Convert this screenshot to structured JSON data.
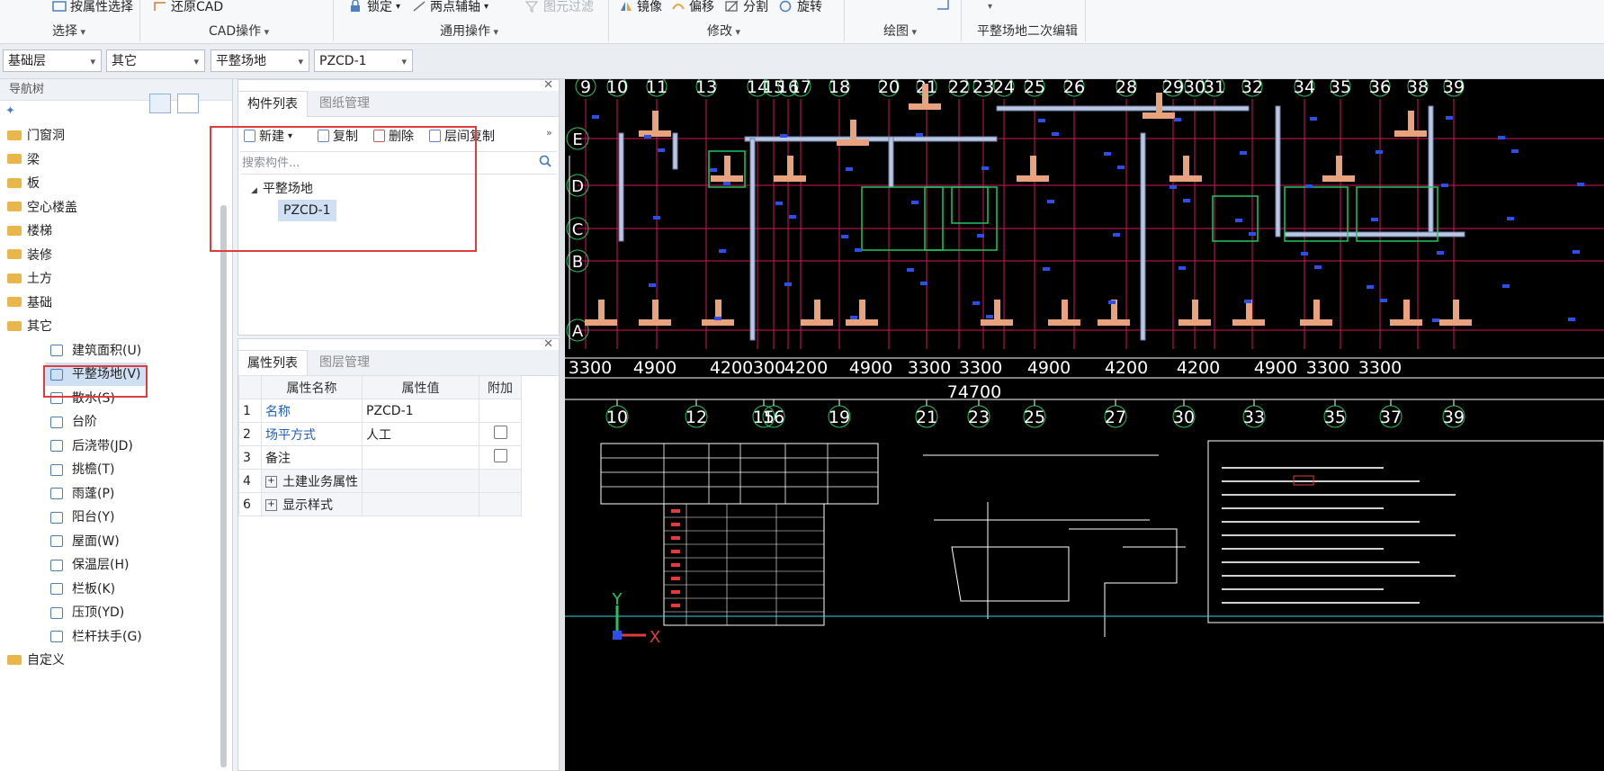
{
  "ribbon": {
    "items": [
      {
        "label": "按属性选择",
        "icon": "select-by-property-icon"
      },
      {
        "label": "还原CAD",
        "icon": "restore-cad-icon"
      },
      {
        "label": "锁定",
        "icon": "lock-icon"
      },
      {
        "label": "两点辅轴",
        "icon": "two-point-axis-icon"
      },
      {
        "label": "图元过滤",
        "icon": "element-filter-icon"
      },
      {
        "label": "镜像",
        "icon": "mirror-icon"
      },
      {
        "label": "偏移",
        "icon": "offset-icon"
      },
      {
        "label": "分割",
        "icon": "split-icon"
      },
      {
        "label": "旋转",
        "icon": "rotate-icon"
      }
    ],
    "groups": [
      "选择",
      "CAD操作",
      "通用操作",
      "修改",
      "绘图",
      "平整场地二次编辑"
    ]
  },
  "combos": [
    "基础层",
    "其它",
    "平整场地",
    "PZCD-1"
  ],
  "nav": {
    "title": "导航树",
    "folders": [
      "门窗洞",
      "梁",
      "板",
      "空心楼盖",
      "楼梯",
      "装修",
      "土方",
      "基础",
      "其它"
    ],
    "other_items": [
      "建筑面积(U)",
      "平整场地(V)",
      "散水(S)",
      "台阶",
      "后浇带(JD)",
      "挑檐(T)",
      "雨蓬(P)",
      "阳台(Y)",
      "屋面(W)",
      "保温层(H)",
      "栏板(K)",
      "压顶(YD)",
      "栏杆扶手(G)"
    ],
    "last_folder": "自定义"
  },
  "component_panel": {
    "tabs": [
      "构件列表",
      "图纸管理"
    ],
    "toolbar": [
      "新建",
      "复制",
      "删除",
      "层间复制"
    ],
    "search_placeholder": "搜索构件...",
    "tree_root": "平整场地",
    "tree_child": "PZCD-1"
  },
  "property_panel": {
    "tabs": [
      "属性列表",
      "图层管理"
    ],
    "headers": [
      "属性名称",
      "属性值",
      "附加"
    ],
    "rows": [
      {
        "num": "1",
        "name": "名称",
        "value": "PZCD-1"
      },
      {
        "num": "2",
        "name": "场平方式",
        "value": "人工"
      },
      {
        "num": "3",
        "name": "备注",
        "value": ""
      },
      {
        "num": "4",
        "name": "土建业务属性",
        "value": ""
      },
      {
        "num": "6",
        "name": "显示样式",
        "value": ""
      }
    ]
  },
  "cad": {
    "top_axis": [
      "9",
      "10",
      "11",
      "13",
      "14",
      "15",
      "16",
      "17",
      "18",
      "20",
      "21",
      "22",
      "23",
      "24",
      "25",
      "26",
      "28",
      "29",
      "30",
      "31",
      "32",
      "34",
      "35",
      "36",
      "38",
      "39"
    ],
    "row_axis": [
      "E",
      "D",
      "C",
      "B",
      "A"
    ],
    "dims": [
      "3300",
      "4900",
      "4200",
      "300",
      "4200",
      "4900",
      "3300",
      "3300",
      "4900",
      "4200",
      "4200",
      "4900",
      "3300",
      "3300"
    ],
    "total_dim": "74700",
    "bottom_axis": [
      "10",
      "12",
      "15",
      "16",
      "19",
      "21",
      "23",
      "25",
      "27",
      "30",
      "33",
      "35",
      "37",
      "39"
    ],
    "ucs_x": "X",
    "ucs_y": "Y"
  },
  "colors": {
    "accent": "#1e5fbf",
    "highlight": "#e23b3b",
    "folder": "#e8b64b",
    "cad_bg": "#000000"
  }
}
